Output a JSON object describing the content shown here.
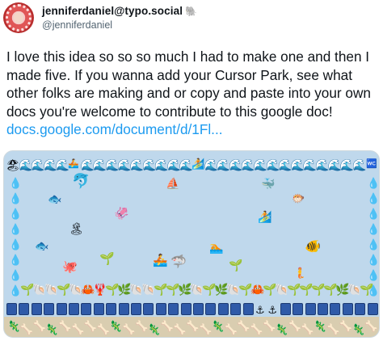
{
  "author": {
    "display_name": "jenniferdaniel@typo.social",
    "name_emoji": "🐘",
    "handle": "@jenniferdaniel"
  },
  "tweet": {
    "text": "I love this idea so so so much I had to make one and then I made five. If you wanna add your Cursor Park, see what other folks are making and or copy and paste into your own docs you're welcome to contribute to this google doc! ",
    "link_text": "docs.google.com/document/d/1Fl..."
  },
  "media": {
    "description": "Emoji cursor park: ocean scene",
    "icons": {
      "wave": "🌊",
      "droplet": "💧",
      "tropical_fish": "🐠",
      "dolphin": "🐬",
      "fish": "🐟",
      "whale": "🐳",
      "sailboat": "⛵",
      "surfer": "🏄",
      "beach": "🏖",
      "squid": "🦑",
      "island": "🏝",
      "octopus": "🐙",
      "seedling": "🌱",
      "rowboat": "🚣",
      "shark": "🦈",
      "mermaid": "🧜",
      "blowfish": "🐡",
      "swimmer": "🏊",
      "shell": "🐚",
      "crab": "🦀",
      "lobster": "🦞",
      "herb": "🌿",
      "anchor": "⚓",
      "lizard": "🦎",
      "bone": "🦴",
      "water_closet": "🚾"
    }
  }
}
